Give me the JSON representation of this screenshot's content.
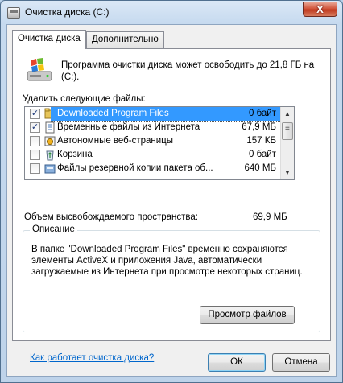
{
  "window": {
    "title": "Очистка диска  (C:)",
    "close_glyph": "X"
  },
  "tabs": [
    {
      "label": "Очистка диска",
      "active": true
    },
    {
      "label": "Дополнительно",
      "active": false
    }
  ],
  "intro_text": "Программа очистки диска может освободить до 21,8 ГБ на  (C:).",
  "list_label": "Удалить следующие файлы:",
  "files": [
    {
      "name": "Downloaded Program Files",
      "size": "0 байт",
      "checked": true,
      "icon": "folder-icon"
    },
    {
      "name": "Временные файлы из Интернета",
      "size": "67,9 МБ",
      "checked": true,
      "icon": "document-icon"
    },
    {
      "name": "Автономные веб-страницы",
      "size": "157 КБ",
      "checked": false,
      "icon": "offline-webpage-icon"
    },
    {
      "name": "Корзина",
      "size": "0 байт",
      "checked": false,
      "icon": "recycle-bin-icon"
    },
    {
      "name": "Файлы резервной копии пакета об...",
      "size": "640 МБ",
      "checked": false,
      "icon": "backup-package-icon"
    }
  ],
  "space": {
    "label": "Объем высвобождаемого пространства:",
    "value": "69,9 МБ"
  },
  "description": {
    "title": "Описание",
    "text": "В папке \"Downloaded Program Files\" временно сохраняются элементы ActiveX и приложения Java, автоматически загружаемые из Интернета при просмотре некоторых страниц."
  },
  "buttons": {
    "view_files": "Просмотр файлов",
    "ok": "ОК",
    "cancel": "Отмена"
  },
  "help_link": "Как работает очистка диска?",
  "colors": {
    "selection": "#3399ff",
    "link": "#0066cc",
    "close_button": "#c03a1f"
  }
}
